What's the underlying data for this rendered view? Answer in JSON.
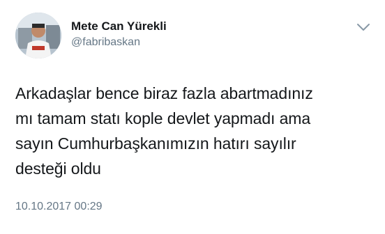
{
  "user": {
    "display_name": "Mete Can Yürekli",
    "handle": "@fabribaskan"
  },
  "tweet": {
    "lines": [
      "Arkadaşlar bence biraz fazla abartmadınız",
      "mı tamam statı kople devlet yapmadı ama",
      "sayın Cumhurbaşkanımızın hatırı sayılır",
      "desteği oldu"
    ],
    "timestamp": "10.10.2017 00:29"
  },
  "icons": {
    "menu": "chevron-down-icon",
    "avatar": "avatar"
  },
  "colors": {
    "text": "#14171a",
    "secondary": "#657786",
    "background": "#ffffff"
  }
}
